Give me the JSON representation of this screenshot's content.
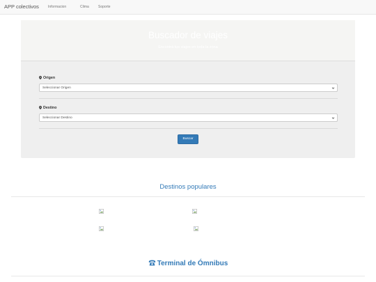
{
  "navbar": {
    "brand": "APP colectivos",
    "links": [
      "Informacion",
      "Clima",
      "Soporte"
    ]
  },
  "hero": {
    "title": "Buscador de viajes",
    "subtitle": "Encontrá tus viajes en toda la zona"
  },
  "form": {
    "origin_label": "Origen",
    "origin_value": "Seleccionar Origen",
    "destination_label": "Destino",
    "destination_value": "Seleccionar Destino",
    "search_button": "Buscar"
  },
  "popular": {
    "title": "Destinos populares"
  },
  "terminal": {
    "title": "Terminal de Ómnibus"
  },
  "colors": {
    "accent": "#337ab7",
    "navbar_bg": "#f8f8f8",
    "panel_bg": "#efefef"
  }
}
